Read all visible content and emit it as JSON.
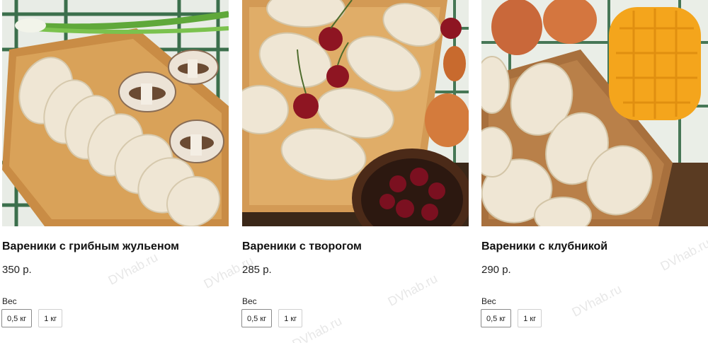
{
  "products": [
    {
      "title": "Вареники с грибным жульеном",
      "price": "350 р.",
      "weight_label": "Вес",
      "options": [
        "0,5 кг",
        "1 кг"
      ],
      "selected": "0,5 кг"
    },
    {
      "title": "Вареники с творогом",
      "price": "285 р.",
      "weight_label": "Вес",
      "options": [
        "0,5 кг",
        "1 кг"
      ],
      "selected": "0,5 кг"
    },
    {
      "title": "Вареники с клубникой",
      "price": "290 р.",
      "weight_label": "Вес",
      "options": [
        "0,5 кг",
        "1 кг"
      ],
      "selected": "0,5 кг"
    }
  ],
  "watermark": "DVhab.ru"
}
